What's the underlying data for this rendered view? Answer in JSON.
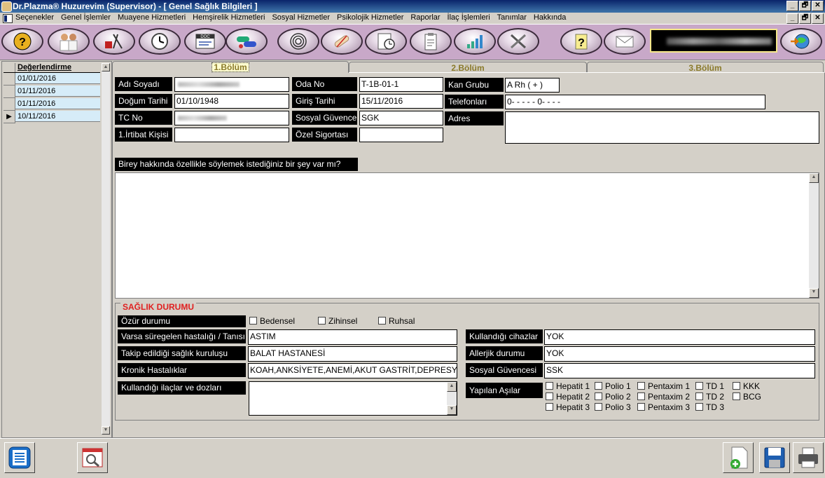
{
  "window": {
    "title": "Dr.Plazma® Huzurevim (Supervisor) - [ Genel Sağlık Bilgileri ]",
    "min": "_",
    "max": "🗗",
    "close": "✕"
  },
  "menu": [
    "Seçenekler",
    "Genel İşlemler",
    "Muayene Hizmetleri",
    "Hemşirelik Hizmetleri",
    "Sosyal Hizmetler",
    "Psikolojik Hizmetler",
    "Raporlar",
    "İlaç İşlemleri",
    "Tanımlar",
    "Hakkında"
  ],
  "toolbar": {
    "icons": [
      "help-head-icon",
      "doctors-icon",
      "nurse-tools-icon",
      "clock-icon",
      "doc-report-icon",
      "pills-icon",
      "spiral-icon",
      "bandage-icon",
      "clock-paper-icon",
      "clipboard-icon",
      "signal-chart-icon",
      "tools-icon",
      "help-note-icon",
      "mail-icon",
      "globe-arrow-icon"
    ],
    "doc_label": "DOC"
  },
  "left_grid": {
    "header": "Değerlendirme",
    "rows": [
      "01/01/2016",
      "01/11/2016",
      "01/11/2016",
      "10/11/2016"
    ],
    "current_marker": "▶"
  },
  "tabs": [
    "1.Bölüm",
    "2.Bölüm",
    "3.Bölüm"
  ],
  "form": {
    "adi_soyadi": {
      "label": "Adı Soyadı"
    },
    "dogum_tarihi": {
      "label": "Doğum Tarihi",
      "value": "01/10/1948"
    },
    "tc_no": {
      "label": "TC No"
    },
    "irtibat": {
      "label": "1.İrtibat Kişisi",
      "value": ""
    },
    "oda_no": {
      "label": "Oda No",
      "value": "T-1B-01-1"
    },
    "giris_tarihi": {
      "label": "Giriş Tarihi",
      "value": "15/11/2016"
    },
    "sosyal_guvence": {
      "label": "Sosyal Güvence",
      "value": "SGK"
    },
    "ozel_sigorta": {
      "label": "Özel Sigortası",
      "value": ""
    },
    "kan_grubu": {
      "label": "Kan Grubu",
      "value": "A Rh ( + )"
    },
    "telefonlari": {
      "label": "Telefonları",
      "value": "0-  -  -  -  - 0-  -  -  -"
    },
    "adres": {
      "label": "Adres",
      "value": ""
    },
    "birey_question": "Birey hakkında özellikle söylemek istediğiniz bir şey var mı?",
    "birey_answer": ""
  },
  "health": {
    "title": "SAĞLIK DURUMU",
    "ozur": {
      "label": "Özür durumu",
      "options": [
        "Bedensel",
        "Zihinsel",
        "Ruhsal"
      ]
    },
    "hastalik": {
      "label": "Varsa süregelen hastalığı / Tanısı",
      "value": "ASTIM"
    },
    "kurulus": {
      "label": "Takip edildiği sağlık kuruluşu",
      "value": "BALAT HASTANESİ"
    },
    "kronik": {
      "label": "Kronik Hastalıklar",
      "value": "KOAH,ANKSİYETE,ANEMİ,AKUT GASTRİT,DEPRESYON"
    },
    "ilaclar": {
      "label": "Kullandığı ilaçlar ve dozları",
      "value": ""
    },
    "cihazlar": {
      "label": "Kullandığı cihazlar",
      "value": "YOK"
    },
    "allerji": {
      "label": "Allerjik durumu",
      "value": "YOK"
    },
    "sosyal": {
      "label": "Sosyal Güvencesi",
      "value": "SSK"
    },
    "asilar": {
      "label": "Yapılan Aşılar",
      "cols": [
        [
          "Hepatit 1",
          "Hepatit 2",
          "Hepatit 3"
        ],
        [
          "Polio 1",
          "Polio 2",
          "Polio 3"
        ],
        [
          "Pentaxim 1",
          "Pentaxim 2",
          "Pentaxim 3"
        ],
        [
          "TD 1",
          "TD 2",
          "TD 3"
        ],
        [
          "KKK",
          "BCG"
        ]
      ]
    }
  },
  "bottom": {
    "left_buttons": [
      "list-icon",
      "report-preview-icon"
    ],
    "right_buttons": [
      "add-document-icon",
      "save-icon",
      "print-icon"
    ]
  }
}
